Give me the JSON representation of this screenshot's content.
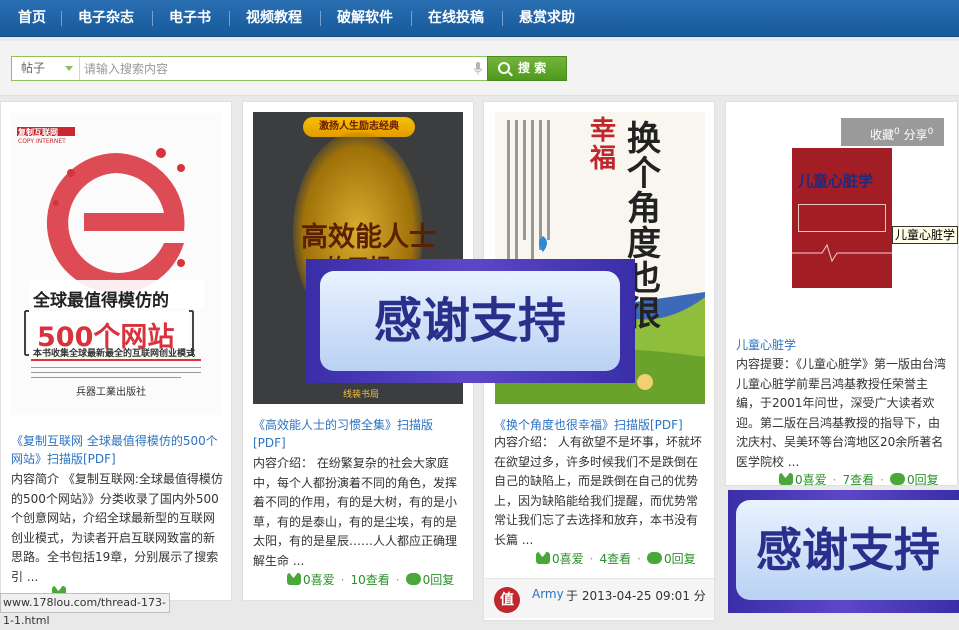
{
  "nav": {
    "items": [
      "首页",
      "电子杂志",
      "电子书",
      "视频教程",
      "破解软件",
      "在线投稿",
      "悬赏求助"
    ]
  },
  "search": {
    "type": "帖子",
    "placeholder": "请输入搜索内容",
    "button": "搜 索"
  },
  "cards": [
    {
      "title": "《复制互联网 全球最值得模仿的500个网站》扫描版[PDF]",
      "desc": "内容简介 《复制互联网:全球最值得模仿的500个网站》》分类收录了国内外500个创意网站，介绍全球最新型的互联网创业模式，为读者开启互联网致富的新思路。全书包括19章，分别展示了搜索引 ...",
      "cover_top": "复制互联网",
      "cover_sub": "COPY INTERNET",
      "cover_main": "全球最值得模仿的",
      "cover_big": "500个网站",
      "cover_note": "本书收集全球最新最全的互联网创业模式"
    },
    {
      "title": "《高效能人士的习惯全集》扫描版[PDF]",
      "desc": "内容介绍： 在纷繁复杂的社会大家庭中，每个人都扮演着不同的角色，发挥着不同的作用，有的是大树，有的是小草，有的是泰山，有的是尘埃，有的是太阳，有的是星辰……人人都应正确理解生命 ...",
      "likes": "0喜爱",
      "views": "10查看",
      "replies": "0回复",
      "cover_banner": "激扬人生励志经典",
      "cover_big": "高效能人士",
      "cover_sub": "的习惯",
      "cover_pub": "线装书局"
    },
    {
      "title": "《换个角度也很幸福》扫描版[PDF]",
      "desc": "内容介绍： 人有欲望不是坏事，坏就坏在欲望过多，许多时候我们不是跌倒在自己的缺陷上，而是跌倒在自己的优势上，因为缺陷能给我们提醒，而优势常常让我们忘了去选择和放弃，本书没有长篇 ...",
      "likes": "0喜爱",
      "views": "4查看",
      "replies": "0回复",
      "user": "Army",
      "post_time": "于 2013-04-25 09:01 分",
      "cover_red": "幸福",
      "cover_black": "换个角度也很"
    },
    {
      "title": "儿童心脏学",
      "desc": "内容提要：《儿童心脏学》第一版由台湾儿童心脏学前辈吕鸿基教授任荣誉主编，于2001年问世，深受广大读者欢迎。第二版在吕鸿基教授的指导下，由沈庆村、吴美环等台湾地区20余所著名医学院校 ...",
      "likes": "0喜爱",
      "views": "7查看",
      "replies": "0回复",
      "fav": "收藏",
      "fav_count": "0",
      "share": "分享",
      "share_count": "0",
      "tooltip": "儿童心脏学",
      "cover_title": "儿童心脏学"
    }
  ],
  "thanks": "感谢支持",
  "status_url": "www.178lou.com/thread-173-1-1.html",
  "colors": {
    "nav": "#1d63a6",
    "search_accent": "#5fa82a",
    "link": "#2b73c3",
    "stats": "#4aa83b"
  }
}
